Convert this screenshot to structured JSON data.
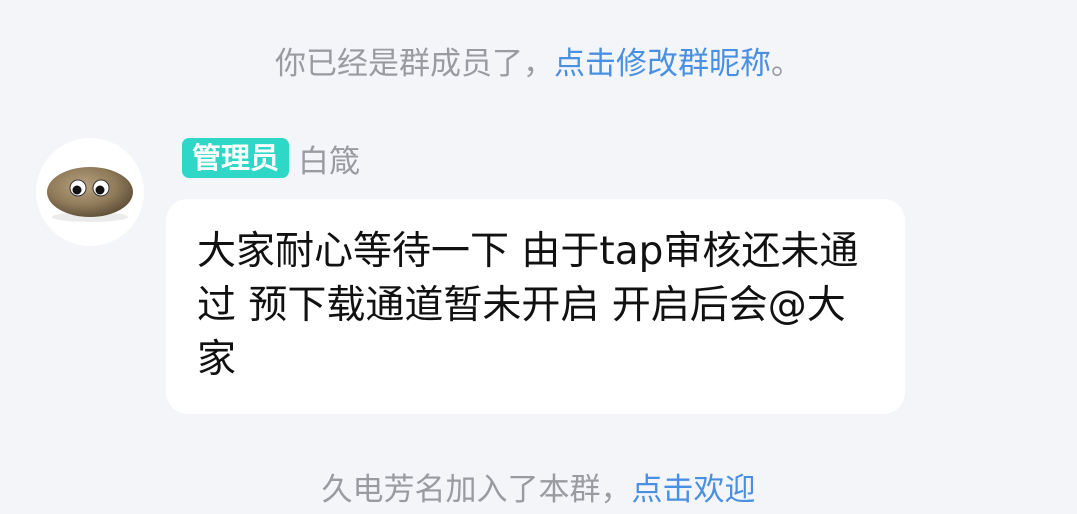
{
  "system_notice": {
    "text": "你已经是群成员了，",
    "link_text": "点击修改群昵称",
    "suffix": "。"
  },
  "message": {
    "role_badge": "管理员",
    "sender_name": "白箴",
    "text": "大家耐心等待一下 由于tap审核还未通过 预下载通道暂未开启 开启后会@大家"
  },
  "bottom_notice": {
    "text": "久电芳名加入了本群，",
    "link_text": "点击欢迎"
  },
  "colors": {
    "background": "#f4f5f9",
    "link": "#4a90e2",
    "badge": "#2fd7c6",
    "notice_text": "#9a9ba1"
  }
}
